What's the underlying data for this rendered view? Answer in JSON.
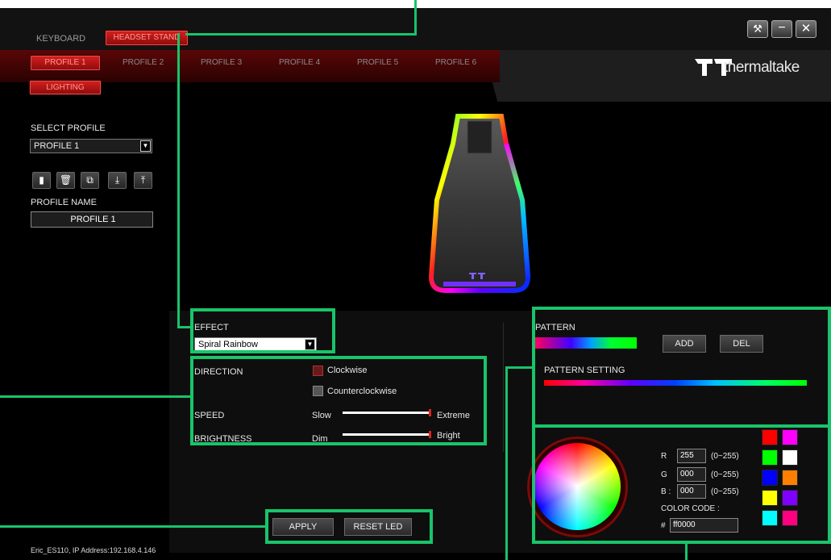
{
  "tabs": {
    "keyboard": "KEYBOARD",
    "headset_stand": "HEADSET STAND"
  },
  "profiles": [
    "PROFILE 1",
    "PROFILE 2",
    "PROFILE 3",
    "PROFILE 4",
    "PROFILE 5",
    "PROFILE 6"
  ],
  "lighting_label": "LIGHTING",
  "window_controls": {
    "settings": "settings-icon",
    "minimize": "minimize-icon",
    "close": "close-icon"
  },
  "brand": {
    "name": "thermaltake",
    "accent": "#d11a1a",
    "highlight": "#19c46a"
  },
  "sidebar": {
    "select_profile_label": "SELECT PROFILE",
    "selected_profile": "PROFILE 1",
    "icons": [
      "save-icon",
      "delete-icon",
      "copy-icon",
      "import-icon",
      "export-icon"
    ],
    "profile_name_label": "PROFILE NAME",
    "profile_name_value": "PROFILE 1"
  },
  "effect": {
    "label": "EFFECT",
    "value": "Spiral Rainbow"
  },
  "direction": {
    "label": "DIRECTION",
    "options": [
      "Clockwise",
      "Counterclockwise"
    ]
  },
  "speed": {
    "label": "SPEED",
    "min": "Slow",
    "max": "Extreme",
    "level": 1.0
  },
  "brightness": {
    "label": "BRIGHTNESS",
    "min": "Dim",
    "max": "Bright",
    "level": 1.0
  },
  "pattern": {
    "label": "PATTERN",
    "add": "ADD",
    "del": "DEL",
    "setting_label": "PATTERN SETTING"
  },
  "color": {
    "r_label": "R",
    "g_label": "G",
    "b_label": "B :",
    "r": "255",
    "g": "000",
    "b": "000",
    "range": "(0~255)",
    "code_label": "COLOR CODE :",
    "hash": "#",
    "code": "ff0000",
    "swatches": [
      "#ff0000",
      "#ff00ff",
      "#00ff00",
      "#ffffff",
      "#0000ff",
      "#ff8000",
      "#ffff00",
      "#8000ff",
      "#00ffff",
      "#ff0080"
    ]
  },
  "actions": {
    "apply": "APPLY",
    "reset": "RESET LED"
  },
  "status": "Eric_ES110, IP Address:192.168.4.146"
}
